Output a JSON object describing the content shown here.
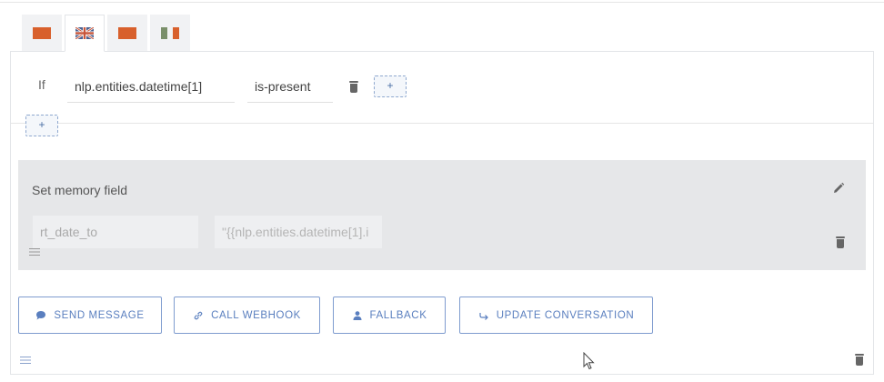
{
  "languages": [
    {
      "code": "lang-1",
      "flag": "solid",
      "color": "#d8602c",
      "active": false
    },
    {
      "code": "en",
      "flag": "uk",
      "active": true
    },
    {
      "code": "lang-3",
      "flag": "solid",
      "color": "#d8602c",
      "active": false
    },
    {
      "code": "it",
      "flag": "italy",
      "colors": [
        "#7a8f6a",
        "#f2f2f2",
        "#d8602c"
      ],
      "active": false
    }
  ],
  "condition": {
    "if_label": "If",
    "entity": "nlp.entities.datetime[1]",
    "operator": "is-present",
    "add_label": "+"
  },
  "add_group_label": "+",
  "memory_action": {
    "title": "Set memory field",
    "key": "rt_date_to",
    "value": "\"{{nlp.entities.datetime[1].i"
  },
  "actions": {
    "send_message": "SEND MESSAGE",
    "call_webhook": "CALL WEBHOOK",
    "fallback": "FALLBACK",
    "update_conversation": "UPDATE CONVERSATION"
  },
  "colors": {
    "accent": "#5a7fbf",
    "flag_orange": "#d8602c",
    "card_bg": "#e6e7e9"
  },
  "icons": {
    "delete": "trash-icon",
    "edit": "pencil-icon",
    "drag": "drag-handle-icon",
    "send_message": "chat-bubble-icon",
    "call_webhook": "link-icon",
    "fallback": "user-icon",
    "update_conversation": "redirect-arrow-icon"
  }
}
